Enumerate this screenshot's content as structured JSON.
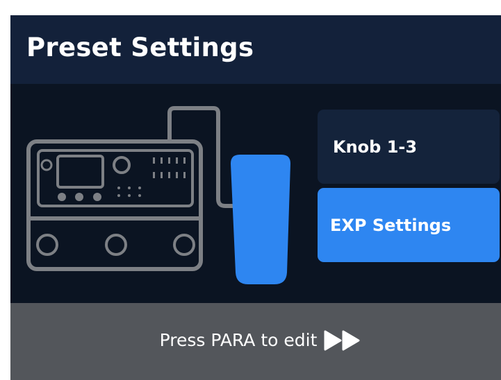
{
  "header": {
    "title": "Preset Settings"
  },
  "illustration": {
    "device_icon": "multi-effects-pedal-icon",
    "pedal_icon": "expression-pedal-icon",
    "stroke_color": "#7d8085",
    "pedal_color": "#2e86f1"
  },
  "menu": {
    "items": [
      {
        "label": "Knob 1-3",
        "selected": false
      },
      {
        "label": "EXP Settings",
        "selected": true
      }
    ],
    "selected_color": "#2e86f1",
    "unselected_color": "#14233b"
  },
  "footer": {
    "hint": "Press PARA to edit",
    "hint_icon": "double-chevron-right-icon"
  }
}
